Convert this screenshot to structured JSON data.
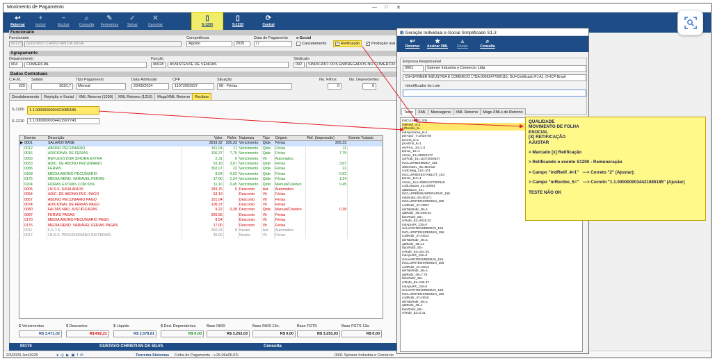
{
  "window": {
    "title": "Movimento de Pagamento",
    "min": "—",
    "max": "□",
    "close": "✕"
  },
  "toolbar": [
    {
      "label": "Retornar",
      "icon": "↩",
      "state": "active"
    },
    {
      "label": "Incluir",
      "icon": "+",
      "state": "dim"
    },
    {
      "label": "Excluir",
      "icon": "−",
      "state": "dim"
    },
    {
      "label": "Consulta",
      "icon": "⌕",
      "state": "dim"
    },
    {
      "label": "Fermentos",
      "icon": "✎",
      "state": "dim"
    },
    {
      "label": "Salvar",
      "icon": "✓",
      "state": "dim"
    },
    {
      "label": "Cancelar",
      "icon": "✕",
      "state": "dim"
    },
    {
      "label": "S-1200",
      "icon": "▯",
      "state": "highlight"
    },
    {
      "label": "S-1210",
      "icon": "▯",
      "state": "active"
    },
    {
      "label": "Central",
      "icon": "⟳",
      "state": "active"
    }
  ],
  "funcionario": {
    "section": "Funcionário",
    "label": "Funcionário",
    "code": "00170",
    "name": "GUSTAVO CHRISTIAN DA SILVA",
    "competencia_label": "Competência",
    "competencia_mes": "Agosto",
    "competencia_ano": "2025",
    "data_pag_label": "Data de Pagamento",
    "data_pag": "/ /",
    "esocial_label": "e-Social",
    "cancelamento": "Cancelamento",
    "retificacao": "Retificação",
    "producao": "Produção real"
  },
  "agrupamento": {
    "section": "Agrupamento",
    "depto_label": "Departamento",
    "depto_code": "004",
    "depto": "COMERCIAL",
    "funcao_label": "Função",
    "funcao_code": "00028",
    "funcao": "ASSISTENTE DE VENDAS",
    "sindicato_label": "Sindicato",
    "sindicato_code": "002",
    "sindicato": "SINDICATO DOS EMPREGADOS NO COMERCIO"
  },
  "contratuais": {
    "section": "Dados Contratuais",
    "chm_label": "C.H.M.",
    "chm": "220",
    "salario_label": "Salário",
    "salario": "3020,7",
    "tipo_label": "Tipo Pagamento",
    "tipo": "Mensal",
    "admissao_label": "Data Admissão",
    "admissao": "23/05/2024",
    "cpf_label": "CPF",
    "cpf": "11072003937",
    "situacao_label": "Situação",
    "situacao": "08 - Férias",
    "filhos_label": "No. Filhos",
    "filhos": "0",
    "dependentes_label": "No. Dependentes",
    "dependentes": "0"
  },
  "tabs": [
    "Desdobramento",
    "Rejeição e-Social",
    "XML Retorno (1200)",
    "XML Retorno (1210)",
    "Msgs/XML Retorno",
    "Recibos"
  ],
  "recibos": {
    "s1200_label": "S-1200",
    "s1200": "1.1.0000000034421085185",
    "s1210_label": "S-1210",
    "s1210": "1.1.0000000034421997743"
  },
  "grid": {
    "headers": [
      "Evento",
      "Descrição",
      "Valor",
      "Refer.",
      "Natureza",
      "Tipo",
      "Origem",
      "Ref. (Impressão)",
      "Evento Tratado"
    ],
    "rows": [
      {
        "evento": "0001",
        "desc": "SALARIO BASE",
        "valor": "2819,32",
        "ref": "205,33",
        "nat": "Vencimento",
        "tipo": "Qtde",
        "origem": "Férias",
        "refimp": "205.33",
        "color": "blk"
      },
      {
        "evento": "0012",
        "desc": "ABONO PECUNIARIO",
        "valor": "151,04",
        "ref": "11",
        "nat": "Vencimento",
        "tipo": "Qtde",
        "origem": "Férias",
        "refimp": "11",
        "color": "green"
      },
      {
        "evento": "0016",
        "desc": "ADICIONAL DE FERIAS",
        "valor": "106,37",
        "ref": "7,75",
        "nat": "Vencimento",
        "tipo": "Qtde",
        "origem": "Férias",
        "refimp": "7.75",
        "color": "green"
      },
      {
        "evento": "0063",
        "desc": "REFLEXO DSR S/HORA EXTRA",
        "valor": "2,31",
        "ref": "0",
        "nat": "Vencimento",
        "tipo": "Vlr",
        "origem": "Automático",
        "refimp": "",
        "color": "green"
      },
      {
        "evento": "0053",
        "desc": "ADIC. DE ABONO PECUNIARIO",
        "valor": "53,18",
        "ref": "3,67",
        "nat": "Vencimento",
        "tipo": "Qtde",
        "origem": "Férias",
        "refimp": "3.67",
        "color": "green"
      },
      {
        "evento": "0086",
        "desc": "FERIAS",
        "valor": "302,07",
        "ref": "22",
        "nat": "Vencimento",
        "tipo": "Qtde",
        "origem": "Férias",
        "refimp": "22",
        "color": "green"
      },
      {
        "evento": "0168",
        "desc": "MEDIA ABONO PECUNIARIO",
        "valor": "8,54",
        "ref": "0,62",
        "nat": "Vencimento",
        "tipo": "Qtde",
        "origem": "Férias",
        "refimp": "0.62",
        "color": "green"
      },
      {
        "evento": "0175",
        "desc": "MEDIA REND. VARIAVEL FERIAS",
        "valor": "17,00",
        "ref": "1,24",
        "nat": "Vencimento",
        "tipo": "Qtde",
        "origem": "Férias",
        "refimp": "1.24",
        "color": "green"
      },
      {
        "evento": "0204",
        "desc": "HORAS EXTRAS COM 65%",
        "valor": "11,10",
        "ref": "0,45",
        "nat": "Vencimento",
        "tipo": "Qtde",
        "origem": "Manual/Coletivo",
        "refimp": "0.45",
        "color": "green"
      },
      {
        "evento": "0005",
        "desc": "I.N.S.S. S/SALARIOS",
        "valor": "283,76",
        "ref": "0",
        "nat": "Desconto",
        "tipo": "Aut",
        "origem": "Automático",
        "refimp": "",
        "color": "red"
      },
      {
        "evento": "0054",
        "desc": "ADIC. DE ABONO PEC. PAGO",
        "valor": "53,19",
        "ref": "",
        "nat": "Desconto",
        "tipo": "Vlr",
        "origem": "Férias",
        "refimp": "",
        "color": "red"
      },
      {
        "evento": "0057",
        "desc": "ABONO PECUNIARIO PAGO",
        "valor": "151,04",
        "ref": "",
        "nat": "Desconto",
        "tipo": "Vlr",
        "origem": "Férias",
        "refimp": "",
        "color": "red"
      },
      {
        "evento": "0074",
        "desc": "ADICIONAL DE FERIAS PAGO",
        "valor": "106,37",
        "ref": "",
        "nat": "Desconto",
        "tipo": "Vlr",
        "origem": "Férias",
        "refimp": "",
        "color": "red"
      },
      {
        "evento": "0080",
        "desc": "FALTAS NAO JUSTIFICADAS",
        "valor": "9,22",
        "ref": "0,38",
        "nat": "Desconto",
        "tipo": "Qtde",
        "origem": "Manual/Coletivo",
        "refimp": "0.38",
        "color": "red"
      },
      {
        "evento": "0087",
        "desc": "FERIAS PAGAS",
        "valor": "266,55",
        "ref": "",
        "nat": "Desconto",
        "tipo": "Vlr",
        "origem": "Férias",
        "refimp": "",
        "color": "red"
      },
      {
        "evento": "0170",
        "desc": "MEDIA ABONO PECUNIARIO PAGO",
        "valor": "8,54",
        "ref": "",
        "nat": "Desconto",
        "tipo": "Vlr",
        "origem": "Férias",
        "refimp": "",
        "color": "red"
      },
      {
        "evento": "0176",
        "desc": "MEDIA REND. VARIAVEL FERIAS PAGAS",
        "valor": "17,00",
        "ref": "",
        "nat": "Desconto",
        "tipo": "Vlr",
        "origem": "Férias",
        "refimp": "",
        "color": "red"
      },
      {
        "evento": "0011",
        "desc": "F.G.T.S.",
        "valor": "260,24",
        "ref": "8",
        "nat": "Neutro",
        "tipo": "Aut",
        "origem": "Automático",
        "refimp": "",
        "color": "grey"
      },
      {
        "evento": "0017",
        "desc": "I.N.S.S. PROVISIONADO EM FERIAS",
        "valor": "35,00",
        "ref": "",
        "nat": "Neutro",
        "tipo": "Vlr",
        "origem": "Férias",
        "refimp": "",
        "color": "grey"
      }
    ]
  },
  "summary": {
    "vencimentos_label": "$ Vencimentos",
    "vencimentos": "R$ 3.471,02",
    "descontos_label": "$ Descontos",
    "descontos": "R$ 892,21",
    "liquido_label": "$ Líquido",
    "liquido": "R$ 2.578,81",
    "dependentes_label": "$ Ded. Dependentes",
    "dependentes": "R$ 0,00",
    "inss_label": "Base INSS",
    "inss": "R$ 3.253,03",
    "inss13_label": "Base INSS 13o.",
    "inss13": "R$ 0,00",
    "fgts_label": "Base FGTS",
    "fgts": "R$ 3.253,03",
    "fgts13_label": "Base FGTS 13o.",
    "fgts13": "R$ 0,00"
  },
  "bottom": {
    "code": "00170",
    "name": "GUSTAVO CHRISTIAN DA SILVA",
    "mode": "Consulta"
  },
  "taskbar": {
    "date": "2/6/2026 Jun/2026",
    "company": "Teorema Sistemas",
    "version": "Folha de Pagamento - v.26.06e06.02i",
    "firm": "0001 Spinner Industria e Comercio"
  },
  "popup": {
    "title": "Geração Individual e-Social Simplificado S1.3",
    "toolbar": [
      {
        "label": "Retornar",
        "icon": "↩",
        "dim": false
      },
      {
        "label": "Assinar XML",
        "icon": "★",
        "dim": false
      },
      {
        "label": "Enviar",
        "icon": "▲",
        "dim": true
      },
      {
        "label": "Consulta",
        "icon": "⌕",
        "dim": false
      }
    ],
    "empresa_label": "Empresa Responsável",
    "empresa_code": "0001",
    "empresa": "Spinner Industria e Comercio Ltda",
    "certificado": "CN=SPINNER INDUSTRIA E COMERCIO LTDA:09062477000115, OU=Certificado PJ A1, O=ICP-Brasil",
    "lote_label": "Identificador do Lote",
    "tabs": [
      "Texto",
      "XML",
      "Mensagens",
      "XML Retorno",
      "Msgs XMLs de Retorno"
    ],
    "xml_lines": [
      "INICLUIR S1.200",
      "indRetif_4=1",
      "nrRecibo_5=",
      "indApuracao_6=1",
      "perApur_7=2025-08",
      "tpAmb_8=1",
      "procEmi_9=1",
      "verProc_10=1.0",
      "tpInsc_12=1",
      "nrInsc_13=09062477",
      "cpfTrab_15=11072003937",
      "INCLUIRIDEMDEV_153",
      "ideDmDev_35=Mensal",
      "codCateg_112=101",
      "INCLUIRIDEESTABLOT_154",
      "tpInsc_113=1",
      "nrInsc_114=09062477000115",
      "codLotacao_41=10001",
      "qtdDiasAv_42=",
      "INCLUIRREMUNPERAPUR_155",
      "matricula_44=00171",
      "INCLUIRITENSREMUN_156",
      "codRubr_47=0001",
      "ideTabRubr_48=1",
      "qtdRubr_49=205.33",
      "fatorRubr_50=",
      "vrRubr_52=2819.32",
      "indApurIR_115=0",
      "SALVARITENSREMUN_156",
      "INCLUIRITENSREMUN_156",
      "codRubr_47=0012",
      "ideTabRubr_48=1",
      "qtdRubr_49=11",
      "fatorRubr_50=",
      "vrRubr_52=151.04",
      "indApurIR_115=0",
      "SALVARITENSREMUN_156",
      "INCLUIRITENSREMUN_156",
      "codRubr_47=0013",
      "ideTabRubr_48=1",
      "qtdRubr_49=7.75",
      "fatorRubr_50=",
      "vrRubr_52=106.37",
      "indApurIR_115=0",
      "SALVARITENSREMUN_156",
      "INCLUIRITENSREMUN_156",
      "codRubr_47=0016",
      "ideTabRubr_48=1",
      "qtdRubr_49=1",
      "fatorRubr_50=",
      "vrRubr_52=2.31"
    ]
  },
  "note": {
    "lines": [
      "QUALIDADE",
      "MOVIMENTO DE FOLHA",
      "ESOCIAL",
      "[X] RETIFICAÇÃO",
      "AJUSTAR",
      "",
      "> Marcado [x] Retificação",
      "",
      "> Retificando o evento S1200 - Remuneração",
      "",
      "> Campo \"indRetif_4=1\"   ---> Correto \"2\" (Ajustar);",
      "",
      "> Campo \"nrRecibo_5=\"   ---> Correto \"1.1.0000000034421085185\" (Ajustar)",
      "",
      "TESTE NÃO OK"
    ]
  },
  "colors": {
    "toolbar": "#1e4c86",
    "highlight": "#ffe86a",
    "arrow": "#e0202a",
    "red_row": "#d00000",
    "green_row": "#178a17"
  }
}
